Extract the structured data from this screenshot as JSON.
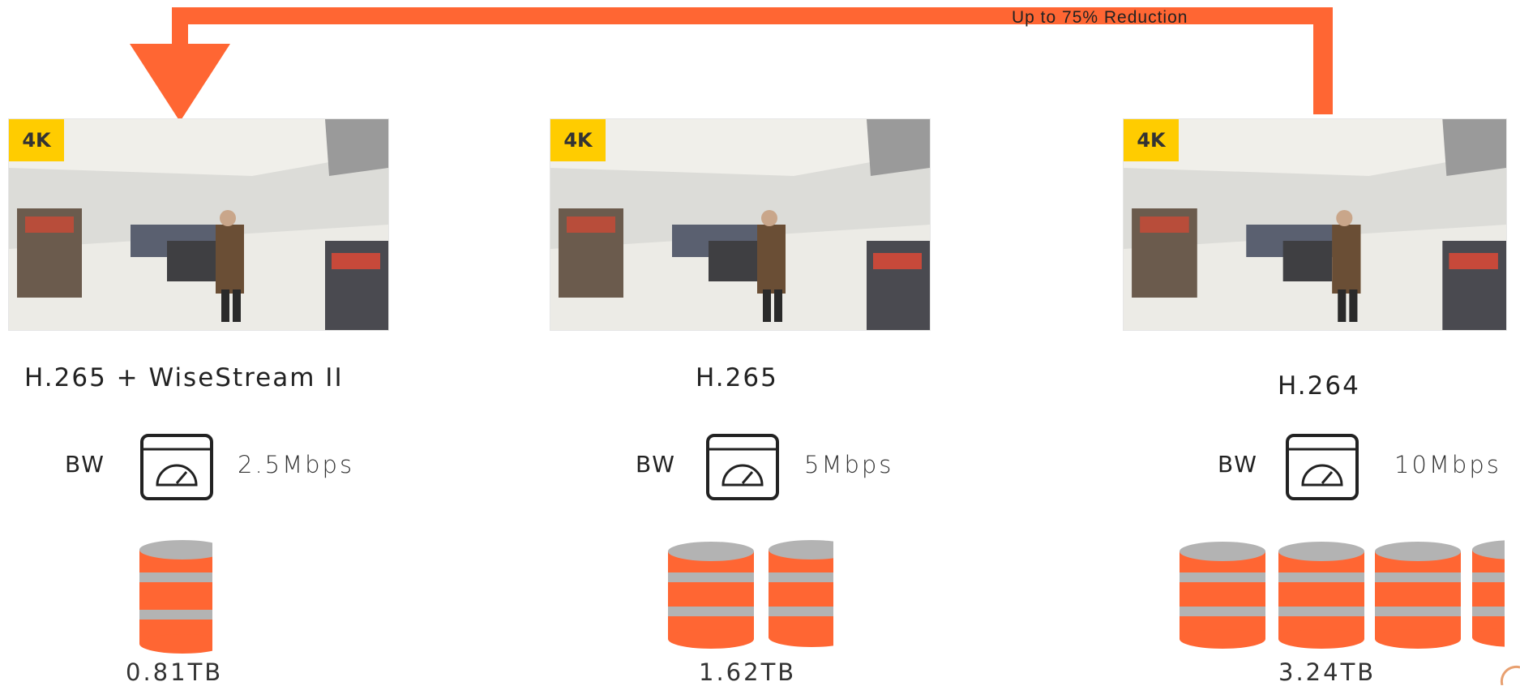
{
  "banner": {
    "label": "Up to 75% Reduction",
    "color": "#ff6633"
  },
  "panels": [
    {
      "badge": "4K",
      "codec": "H.265 + WiseStream II",
      "bw_label": "BW",
      "bw_value": "2.5Mbps",
      "storage": "0.81TB",
      "gauge_icon": "speedometer-icon",
      "db_icon": "database-icon"
    },
    {
      "badge": "4K",
      "codec": "H.265",
      "bw_label": "BW",
      "bw_value": "5Mbps",
      "storage": "1.62TB",
      "gauge_icon": "speedometer-icon",
      "db_icon": "database-icon"
    },
    {
      "badge": "4K",
      "codec": "H.264",
      "bw_label": "BW",
      "bw_value": "10Mbps",
      "storage": "3.24TB",
      "gauge_icon": "speedometer-icon",
      "db_icon": "database-icon"
    }
  ],
  "colors": {
    "accent": "#ff6633",
    "disk_band": "#b3b3b3",
    "badge": "#ffcc00"
  }
}
